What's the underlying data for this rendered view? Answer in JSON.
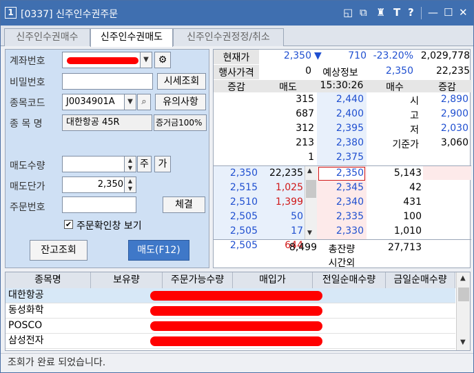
{
  "titlebar": {
    "window_number": "1",
    "title": "[0337] 신주인수권주문",
    "controls": [
      "◱",
      "⧉",
      "♜",
      "T",
      "?",
      "—",
      "☐",
      "✕"
    ]
  },
  "tabs": [
    {
      "label": "신주인수권매수",
      "active": false
    },
    {
      "label": "신주인수권매도",
      "active": true
    },
    {
      "label": "신주인수권정정/취소",
      "active": false
    }
  ],
  "form": {
    "account_label": "계좌번호",
    "password_label": "비밀번호",
    "quote_view_button": "시세조회",
    "code_label": "종목코드",
    "code_value": "J0034901A",
    "notice_button": "유의사항",
    "name_label": "종 목 명",
    "name_value": "대한항공 45R",
    "margin_value": "증거금100%",
    "qty_label": "매도수량",
    "qty_btn_1": "주",
    "qty_btn_2": "가",
    "price_label": "매도단가",
    "price_value": "2,350",
    "order_no_label": "주문번호",
    "fill_button": "체결",
    "confirm_label": "주문확인창 보기",
    "confirm_checked": true,
    "balance_button": "잔고조회",
    "sell_button": "매도(F12)"
  },
  "quote": {
    "cur_label": "현재가",
    "cur_price": "2,350",
    "change_arrow": "▼",
    "change": "710",
    "change_pct": "-23.20%",
    "volume": "2,029,778",
    "exercise_label": "행사가격",
    "exercise_value": "0",
    "expect_label": "예상정보",
    "expect_price": "2,350",
    "expect_volume": "22,235",
    "headers": {
      "inc1": "증감",
      "sell": "매도",
      "time": "15:30:26",
      "buy": "매수",
      "inc2": "증감"
    },
    "ask_rows": [
      {
        "qty": "315",
        "price": "2,440",
        "lbl": "시",
        "val": "2,890"
      },
      {
        "qty": "687",
        "price": "2,400",
        "lbl": "고",
        "val": "2,900"
      },
      {
        "qty": "312",
        "price": "2,395",
        "lbl": "저",
        "val": "2,030"
      },
      {
        "qty": "213",
        "price": "2,380",
        "lbl": "기준가",
        "val": "3,060"
      },
      {
        "qty": "1",
        "price": "2,375",
        "lbl": "",
        "val": ""
      }
    ],
    "bid_rows": [
      {
        "left": "2,350",
        "mid": "22,235",
        "price": "2,350",
        "qty": "5,143"
      },
      {
        "left": "2,515",
        "mid": "1,025",
        "price": "2,345",
        "qty": "42"
      },
      {
        "left": "2,510",
        "mid": "1,399",
        "price": "2,340",
        "qty": "431"
      },
      {
        "left": "2,505",
        "mid": "50",
        "price": "2,335",
        "qty": "100"
      },
      {
        "left": "2,505",
        "mid": "17",
        "price": "2,330",
        "qty": "1,010"
      },
      {
        "left": "2,505",
        "mid": "644",
        "price": "",
        "qty": ""
      }
    ],
    "total_sell": "8,499",
    "total_label": "총잔량",
    "total_buy": "27,713",
    "after_hours_label": "시간외"
  },
  "holdings": {
    "headers": [
      "종목명",
      "보유량",
      "주문가능수량",
      "매입가",
      "전일순매수량",
      "금일순매수량"
    ],
    "rows": [
      "대한항공",
      "동성화학",
      "POSCO",
      "삼성전자"
    ]
  },
  "status": "조회가 완료 되었습니다.",
  "colors": {
    "title_bg": "#3f6fb0",
    "sell_button_bg": "#3f78c8",
    "panel_bg": "#cfe0f4",
    "down": "#1f4fd0",
    "up": "#d01818"
  }
}
